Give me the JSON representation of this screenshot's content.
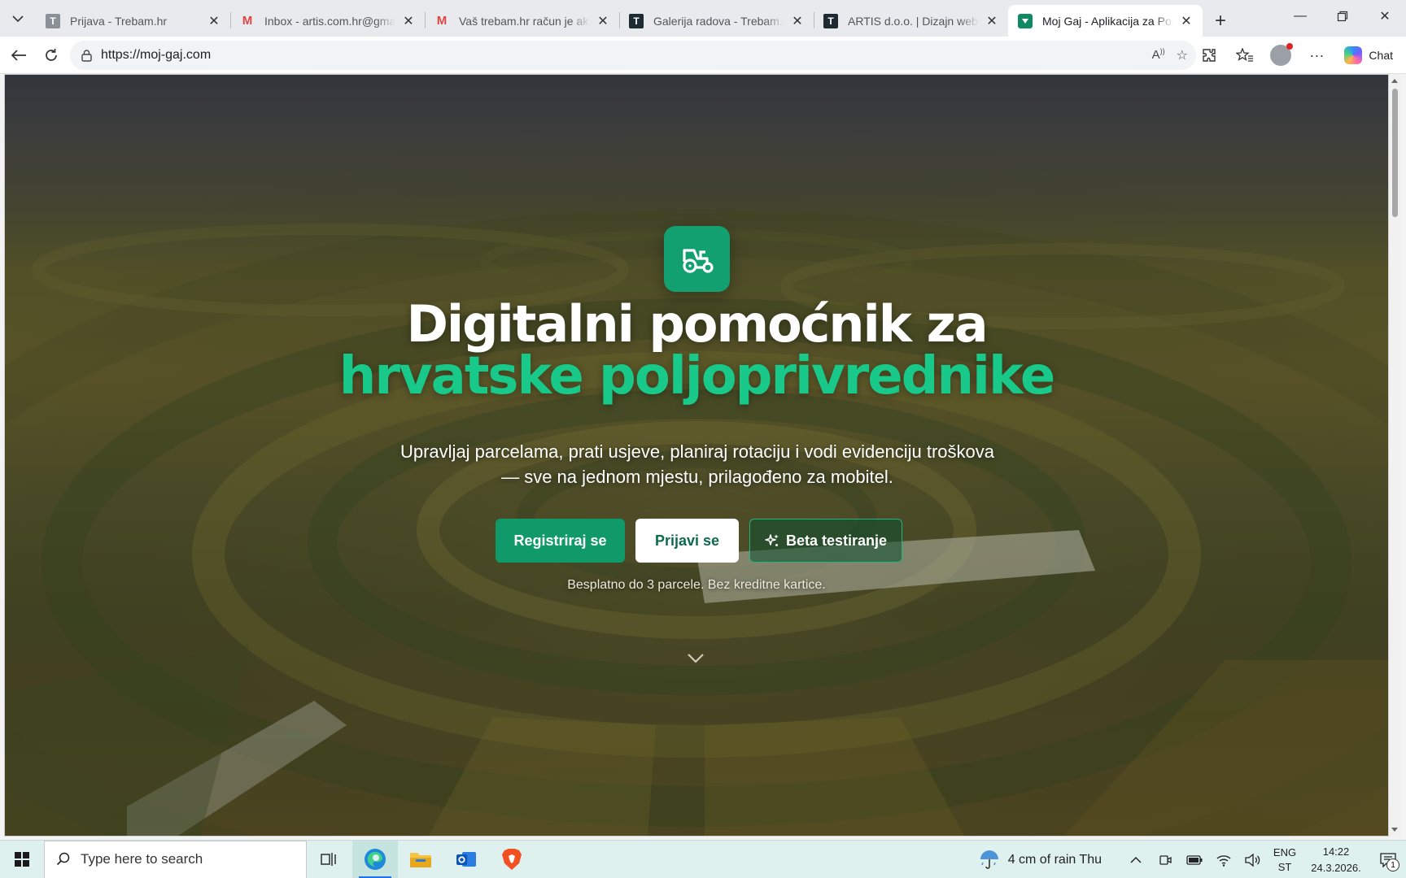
{
  "browser": {
    "tabs": [
      {
        "title": "Prijava - Trebam.hr",
        "favicon": "trebam-icon",
        "active": false
      },
      {
        "title": "Inbox - artis.com.hr@gmail.com",
        "favicon": "gmail-icon",
        "active": false
      },
      {
        "title": "Vaš trebam.hr račun je aktiviran",
        "favicon": "gmail-icon",
        "active": false
      },
      {
        "title": "Galerija radova - Trebam.hr",
        "favicon": "trebam-icon",
        "active": false
      },
      {
        "title": "ARTIS d.o.o. | Dizajn web stranica",
        "favicon": "trebam-icon",
        "active": false
      },
      {
        "title": "Moj Gaj - Aplikacija za Poljoprivrednike",
        "favicon": "mojgaj-icon",
        "active": true
      }
    ],
    "address": "https://moj-gaj.com",
    "chat_label": "Chat"
  },
  "page": {
    "headline_line1": "Digitalni pomoćnik za",
    "headline_line2": "hrvatske poljoprivrednike",
    "subtitle_line1": "Upravljaj parcelama, prati usjeve, planiraj rotaciju i vodi evidenciju troškova",
    "subtitle_line2": "— sve na jednom mjestu, prilagođeno za mobitel.",
    "buttons": {
      "register": "Registriraj se",
      "login": "Prijavi se",
      "beta": "Beta testiranje"
    },
    "note": "Besplatno do 3 parcele. Bez kreditne kartice.",
    "colors": {
      "accent": "#12a070",
      "headline_accent": "#18c98a"
    }
  },
  "taskbar": {
    "search_placeholder": "Type here to search",
    "weather": "4 cm of rain Thu",
    "lang_line1": "ENG",
    "lang_line2": "ST",
    "time": "14:22",
    "date": "24.3.2026.",
    "notification_count": "1"
  }
}
